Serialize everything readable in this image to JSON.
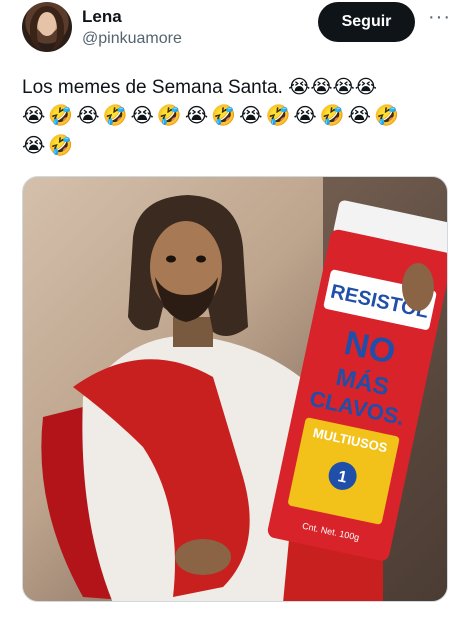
{
  "author": {
    "name": "Lena",
    "handle": "@pinkuamore"
  },
  "actions": {
    "follow_label": "Seguir",
    "more_label": "···"
  },
  "tweet": {
    "text": "Los memes de Semana Santa. 😭😭😭😭",
    "emoji_line_1": "😭🤣😭🤣😭🤣😭🤣😭🤣😭🤣😭🤣",
    "emoji_line_2": "😭🤣"
  },
  "media": {
    "product": {
      "brand": "RESISTOL",
      "slogan_1": "NO",
      "slogan_2": "MÁS",
      "slogan_3": "CLAVOS.",
      "variant": "MULTIUSOS",
      "net_content": "Cnt. Net. 100g",
      "badge": "1"
    },
    "colors": {
      "tube_red": "#d8232a",
      "tube_white": "#f3f3f3",
      "sash_red": "#c8201f",
      "chair_red": "#b3141a",
      "label_blue": "#1f4fa8",
      "label_yellow": "#f2c21b"
    }
  }
}
